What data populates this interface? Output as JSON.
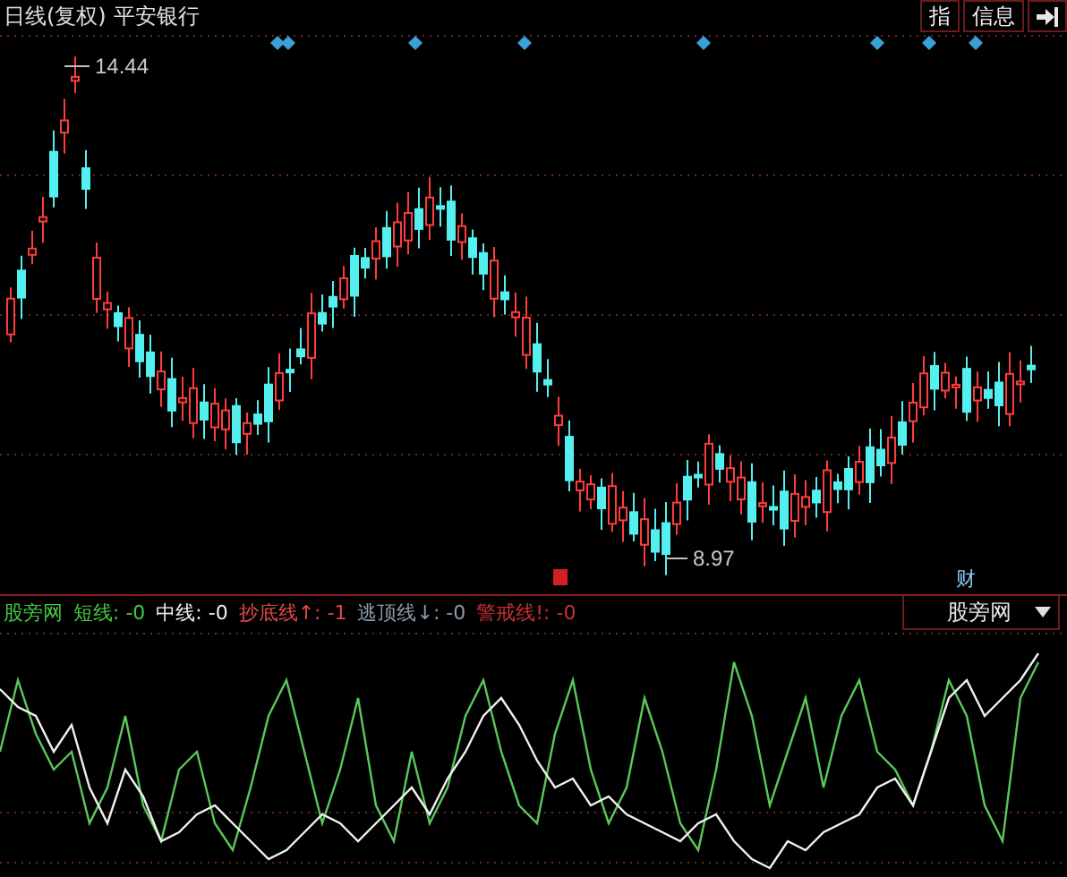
{
  "title": {
    "period": "日线(复权)",
    "stock": "平安银行"
  },
  "toolbar": [
    {
      "kind": "text",
      "label": "指"
    },
    {
      "kind": "text",
      "label": "信息"
    },
    {
      "kind": "icon"
    }
  ],
  "price_chart": {
    "high_label": "14.44",
    "low_label": "8.97",
    "event_markers": [
      {
        "label": "财"
      }
    ]
  },
  "indicator": {
    "name": "股旁网",
    "selector": "股旁网",
    "readings": [
      {
        "label": "短线:",
        "value": "-0",
        "color": "#44c844"
      },
      {
        "label": "中线:",
        "value": "-0",
        "color": "#f0f0f0"
      },
      {
        "label": "抄底线↑:",
        "value": "-1",
        "color": "#e04848"
      },
      {
        "label": "逃顶线↓:",
        "value": "-0",
        "color": "#8a9cab"
      },
      {
        "label": "警戒线!:",
        "value": "-0",
        "color": "#c83030"
      }
    ]
  }
}
